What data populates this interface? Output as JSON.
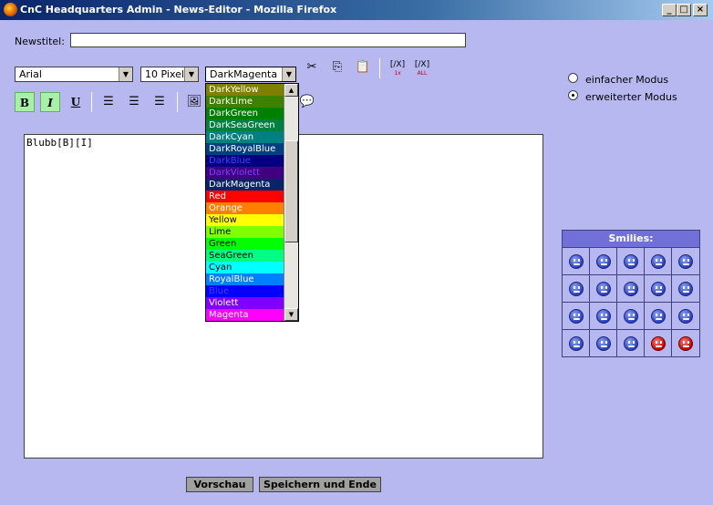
{
  "window": {
    "title": "CnC Headquarters Admin - News-Editor - Mozilla Firefox"
  },
  "form": {
    "title_label": "Newstitel:",
    "title_value": ""
  },
  "toolbar": {
    "font_value": "Arial",
    "size_value": "10 Pixel",
    "color_value": "DarkMagenta",
    "bold_label": "B",
    "italic_label": "I",
    "underline_label": "U",
    "code_remove_1": "[/X]",
    "code_remove_1_sub": "1x",
    "code_remove_all": "[/X]",
    "code_remove_all_sub": "ALL"
  },
  "color_options": [
    {
      "label": "DarkYellow",
      "bg": "#808000",
      "fg": "#ffffff"
    },
    {
      "label": "DarkLime",
      "bg": "#408000",
      "fg": "#ffffff"
    },
    {
      "label": "DarkGreen",
      "bg": "#008000",
      "fg": "#ffffff"
    },
    {
      "label": "DarkSeaGreen",
      "bg": "#008040",
      "fg": "#ffffff"
    },
    {
      "label": "DarkCyan",
      "bg": "#008080",
      "fg": "#ffffff"
    },
    {
      "label": "DarkRoyalBlue",
      "bg": "#004080",
      "fg": "#ffffff"
    },
    {
      "label": "DarkBlue",
      "bg": "#000080",
      "fg": "#4040ff"
    },
    {
      "label": "DarkViolett",
      "bg": "#400080",
      "fg": "#8040ff"
    },
    {
      "label": "DarkMagenta",
      "bg": "#0a246a",
      "fg": "#ffffff"
    },
    {
      "label": "Red",
      "bg": "#ff0000",
      "fg": "#ffffff"
    },
    {
      "label": "Orange",
      "bg": "#ff8000",
      "fg": "#ffffff"
    },
    {
      "label": "Yellow",
      "bg": "#ffff00",
      "fg": "#000000"
    },
    {
      "label": "Lime",
      "bg": "#80ff00",
      "fg": "#000000"
    },
    {
      "label": "Green",
      "bg": "#00ff00",
      "fg": "#000000"
    },
    {
      "label": "SeaGreen",
      "bg": "#00ff80",
      "fg": "#000000"
    },
    {
      "label": "Cyan",
      "bg": "#00ffff",
      "fg": "#000000"
    },
    {
      "label": "RoyalBlue",
      "bg": "#0080ff",
      "fg": "#ffffff"
    },
    {
      "label": "Blue",
      "bg": "#0000ff",
      "fg": "#4040ff"
    },
    {
      "label": "Violett",
      "bg": "#8000ff",
      "fg": "#ffffff"
    },
    {
      "label": "Magenta",
      "bg": "#ff00ff",
      "fg": "#ffffff"
    }
  ],
  "editor": {
    "content": "Blubb[B][I]"
  },
  "mode": {
    "simple_label": "einfacher Modus",
    "advanced_label": "erweiterter Modus",
    "selected": "advanced"
  },
  "smilies": {
    "header": "Smilies:"
  },
  "buttons": {
    "preview_label": "Vorschau",
    "save_label": "Speichern und Ende"
  }
}
